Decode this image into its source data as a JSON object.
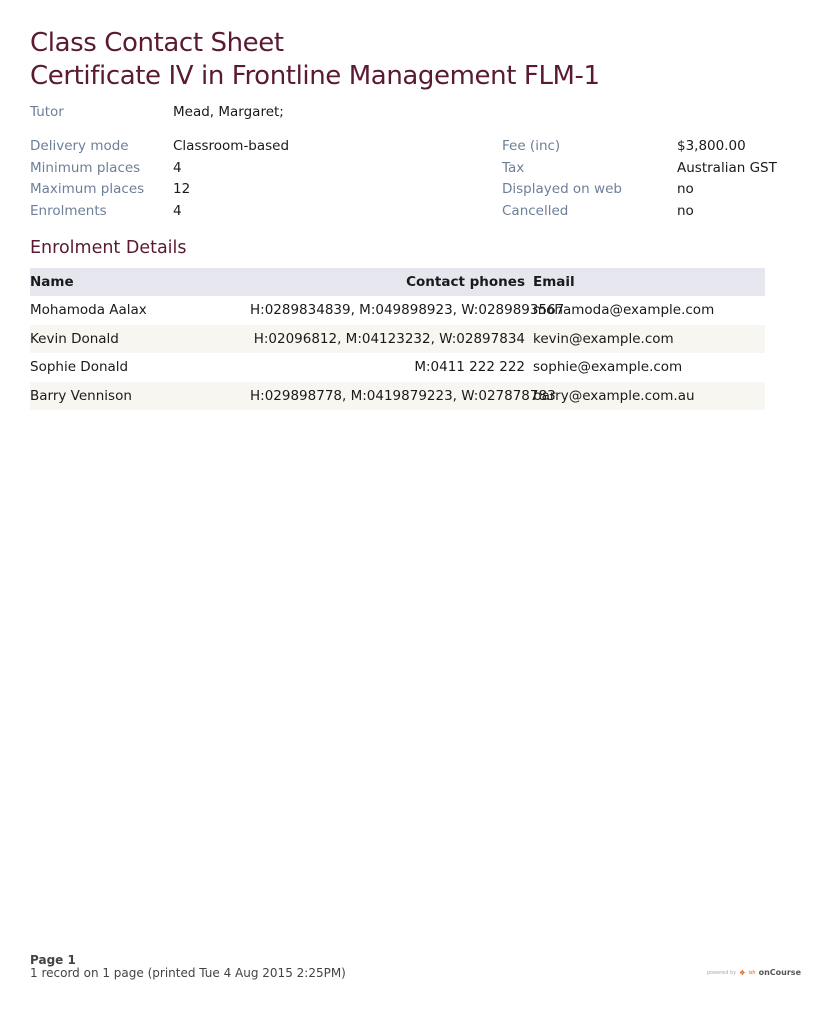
{
  "header": {
    "title": "Class Contact Sheet",
    "subtitle": "Certificate IV in Frontline Management FLM-1"
  },
  "tutor": {
    "label": "Tutor",
    "value": "Mead, Margaret;"
  },
  "details_left": [
    {
      "label": "Delivery mode",
      "value": "Classroom-based"
    },
    {
      "label": "Minimum places",
      "value": "4"
    },
    {
      "label": "Maximum places",
      "value": "12"
    },
    {
      "label": "Enrolments",
      "value": "4"
    }
  ],
  "details_right": [
    {
      "label": "Fee (inc)",
      "value": "$3,800.00"
    },
    {
      "label": "Tax",
      "value": "Australian GST"
    },
    {
      "label": "Displayed on web",
      "value": "no"
    },
    {
      "label": "Cancelled",
      "value": "no"
    }
  ],
  "enrolments": {
    "title": "Enrolment Details",
    "columns": {
      "name": "Name",
      "phones": "Contact phones",
      "email": "Email"
    },
    "rows": [
      {
        "name": "Mohamoda Aalax",
        "phones": "H:0289834839, M:049898923, W:0289893567",
        "email": "mohamoda@example.com"
      },
      {
        "name": "Kevin Donald",
        "phones": "H:02096812, M:04123232, W:02897834",
        "email": "kevin@example.com"
      },
      {
        "name": "Sophie Donald",
        "phones": "M:0411 222 222",
        "email": "sophie@example.com"
      },
      {
        "name": "Barry Vennison",
        "phones": "H:029898778, M:0419879223, W:027878783",
        "email": "barry@example.com.au"
      }
    ]
  },
  "footer": {
    "page": "Page 1",
    "records": "1 record on 1 page (printed Tue 4 Aug 2015 2:25PM)",
    "powered_by": "powered by",
    "brand_logo": "ish",
    "brand_name": "onCourse"
  }
}
